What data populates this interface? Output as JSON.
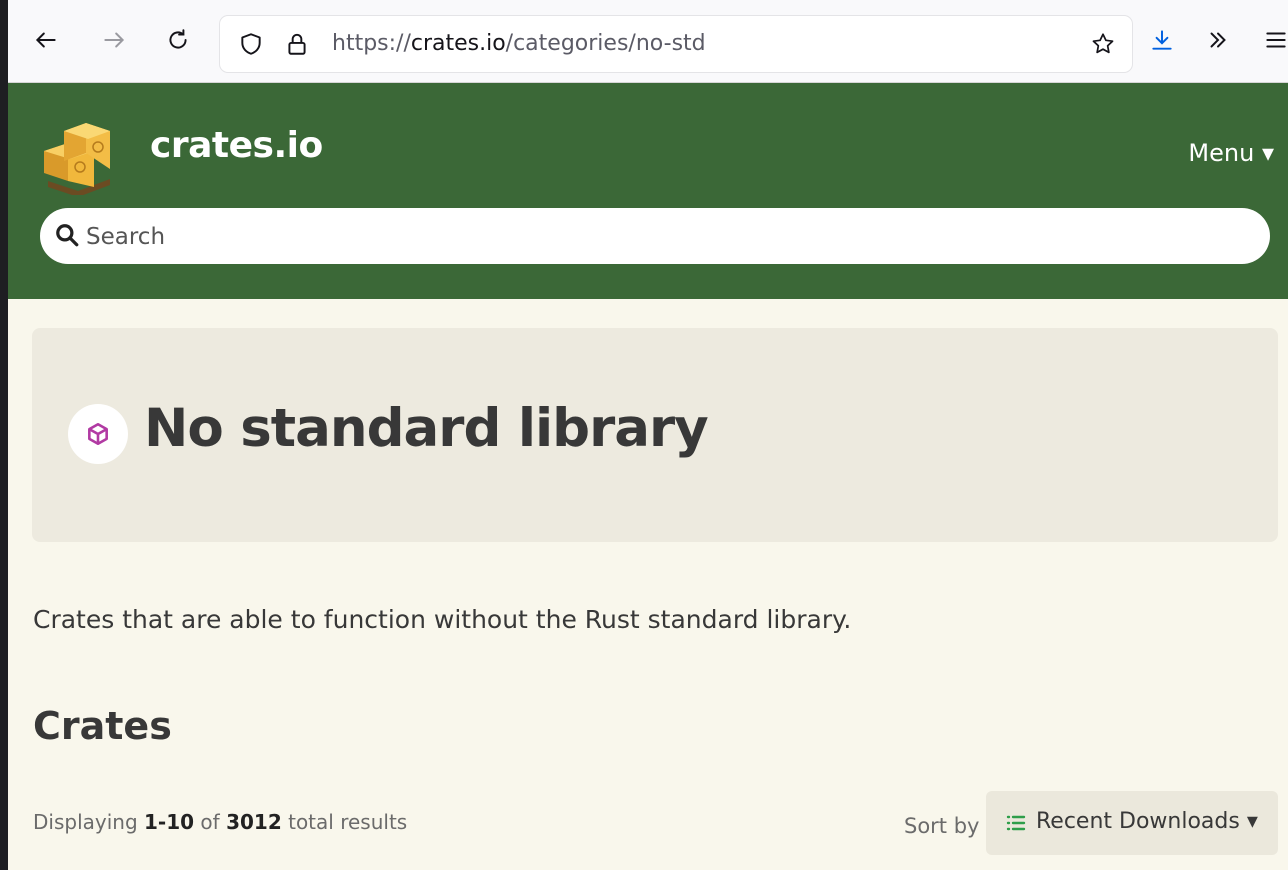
{
  "browser": {
    "url_scheme": "https://",
    "url_host": "crates.io",
    "url_path": "/categories/no-std"
  },
  "header": {
    "site_name": "crates.io",
    "menu_label": "Menu ▾",
    "search_placeholder": "Search",
    "brand_color": "#3b6837"
  },
  "category": {
    "title": "No standard library",
    "description": "Crates that are able to function without the Rust standard library.",
    "icon": "cube-icon"
  },
  "crates": {
    "section_title": "Crates",
    "results_prefix": "Displaying ",
    "results_range": "1-10",
    "results_of": " of ",
    "results_total": "3012",
    "results_suffix": " total results",
    "sort_label": "Sort by",
    "sort_value": "Recent Downloads ▾"
  }
}
